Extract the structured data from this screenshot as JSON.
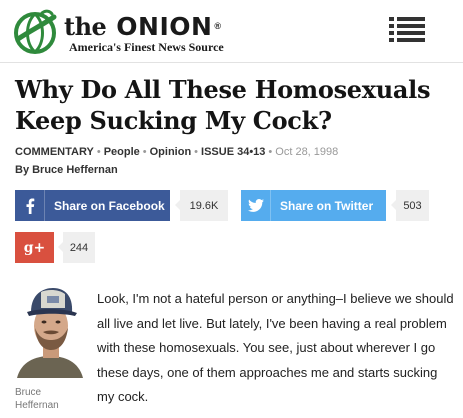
{
  "header": {
    "logo_word_the": "the",
    "logo_word_onion": "ONION",
    "logo_reg": "®",
    "tagline": "America's Finest News Source",
    "menu_icon": "hamburger-menu-icon"
  },
  "article": {
    "title": "Why Do All These Homosexuals Keep Sucking My Cock?",
    "meta": {
      "section": "COMMENTARY",
      "category1": "People",
      "category2": "Opinion",
      "issue": "ISSUE 34•13",
      "date": "Oct 28, 1998",
      "separator": "•"
    },
    "byline": "By Bruce Heffernan",
    "author_name": "Bruce Heffernan",
    "body": "Look, I'm not a hateful person or anything–I believe we should all live and let live. But lately, I've been having a real problem with these homosexuals. You see, just about wherever I go these days, one of them approaches me and starts sucking my cock."
  },
  "share": {
    "facebook": {
      "label": "Share on Facebook",
      "count": "19.6K",
      "icon": "facebook-icon",
      "color": "#3c5a99"
    },
    "twitter": {
      "label": "Share on Twitter",
      "count": "503",
      "icon": "twitter-bird-icon",
      "color": "#55acee"
    },
    "googleplus": {
      "label": "g+",
      "count": "244",
      "icon": "google-plus-icon",
      "color": "#d9503f"
    }
  },
  "colors": {
    "logo_green": "#2f8a3c",
    "text": "#1a1a1a",
    "meta_gray": "#999999"
  }
}
